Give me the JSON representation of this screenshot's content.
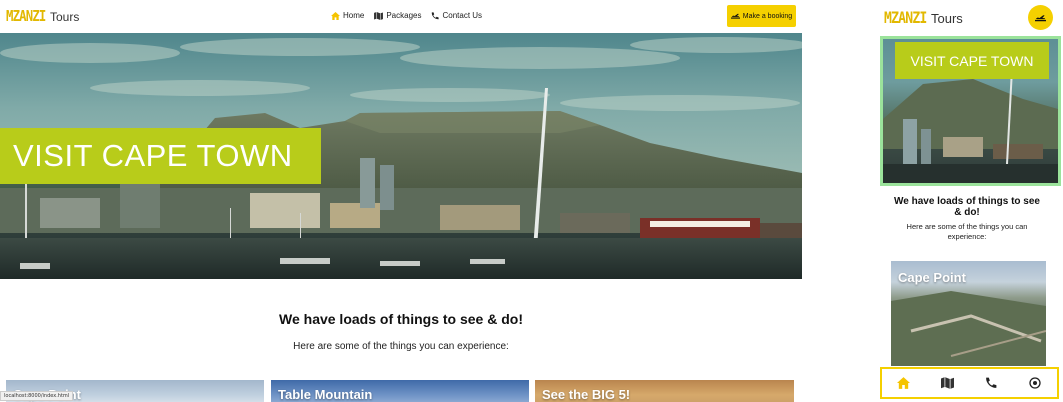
{
  "brand": {
    "logo": "MZANZI",
    "sub": "Tours"
  },
  "nav": {
    "home": "Home",
    "packages": "Packages",
    "contact": "Contact Us",
    "booking": "Make a booking"
  },
  "hero": {
    "title": "VISIT CAPE TOWN"
  },
  "intro": {
    "title": "We have loads of things to see & do!",
    "subtitle": "Here are some of the things you can experience:"
  },
  "cards": [
    {
      "label": "Cape Point"
    },
    {
      "label": "Table Mountain"
    },
    {
      "label": "See the BIG 5!"
    }
  ],
  "status_url": "localhost:8000/index.html",
  "mobile": {
    "hero_title": "VISIT CAPE TOWN",
    "title": "We have loads of things to see & do!",
    "subtitle": "Here are some of the things you can experience:",
    "card_label": "Cape Point"
  },
  "colors": {
    "accent": "#f5d000",
    "brand": "#e2b800",
    "hero_banner": "#b8cc1a",
    "mobile_frame": "#9be39b"
  },
  "icons": {
    "home": "home-icon",
    "packages": "map-icon",
    "contact": "phone-icon",
    "booking": "plane-icon",
    "other": "compass-icon"
  }
}
